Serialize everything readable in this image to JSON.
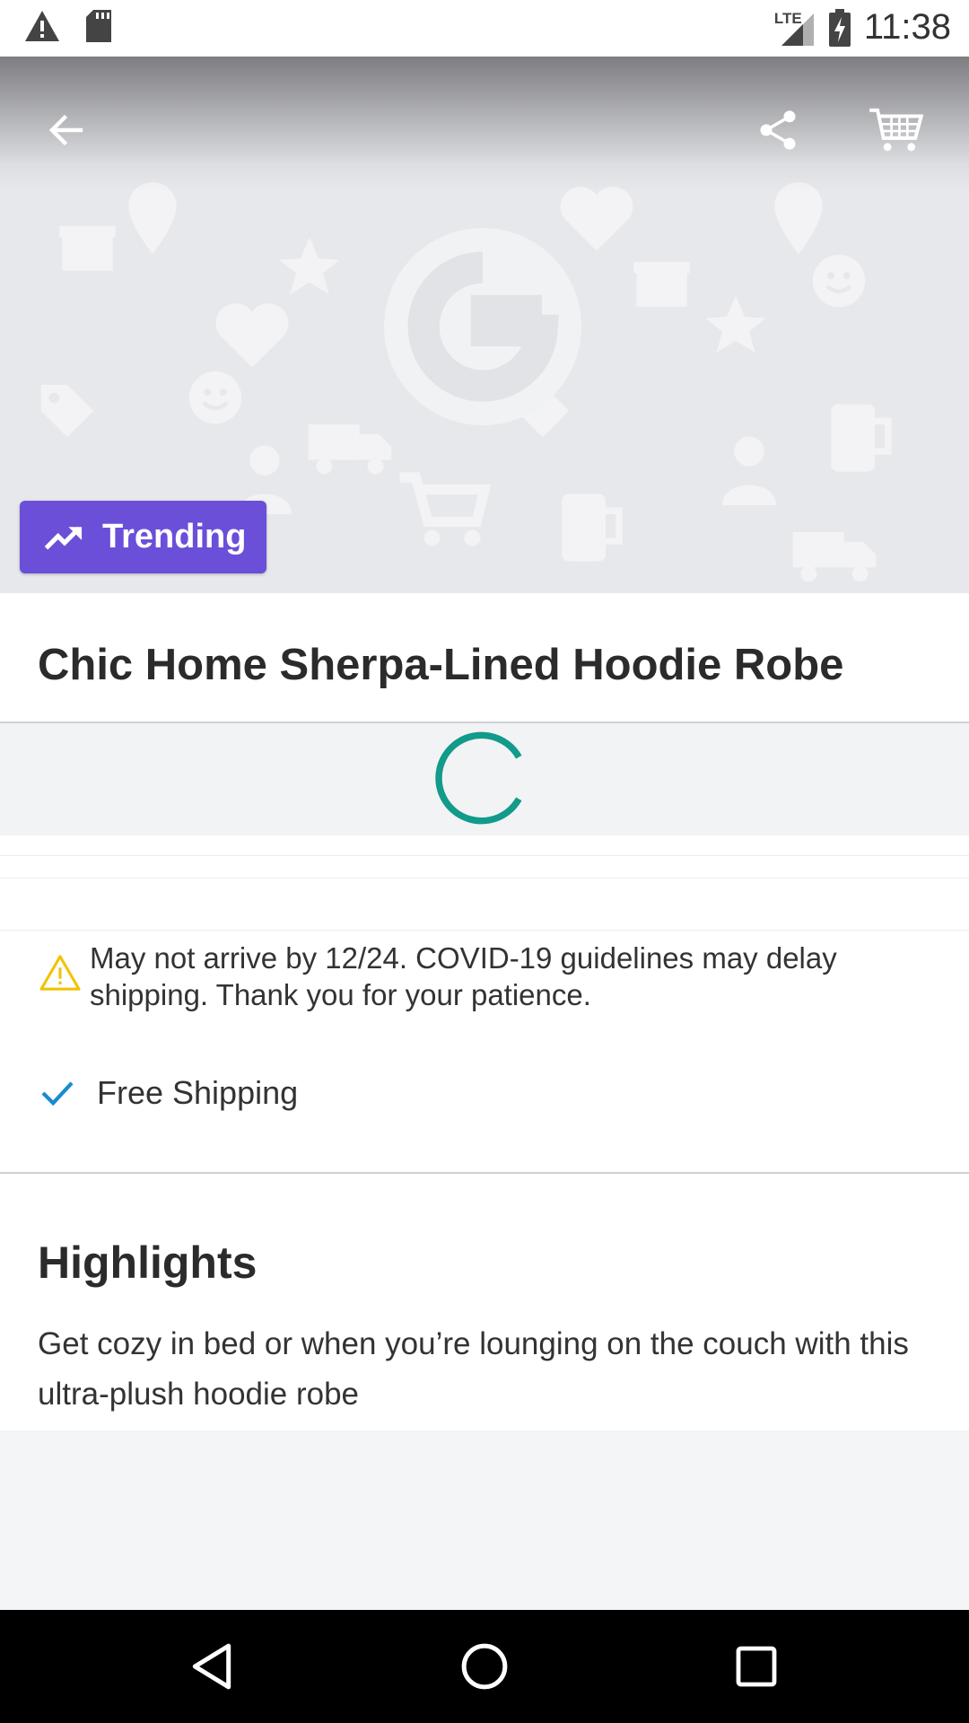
{
  "status_bar": {
    "time": "11:38",
    "network": "LTE",
    "icons": [
      "warning-icon",
      "sd-card-icon",
      "signal-icon",
      "battery-charging-icon"
    ]
  },
  "toolbar": {
    "back_icon": "arrow-back-icon",
    "share_icon": "share-icon",
    "cart_icon": "cart-icon"
  },
  "badge": {
    "label": "Trending",
    "icon": "trending-up-icon",
    "color": "#6b4fd8"
  },
  "product": {
    "title": "Chic Home Sherpa-Lined Hoodie Robe"
  },
  "shipping": {
    "notice": "May not arrive by 12/24. COVID-19 guidelines may delay shipping. Thank you for your patience.",
    "free_shipping": "Free Shipping",
    "warning_color": "#f2c200",
    "check_color": "#1a8bd0"
  },
  "highlights": {
    "heading": "Highlights",
    "text": "Get cozy in bed or when you’re lounging on the couch with this ultra-plush hoodie robe"
  },
  "loading": {
    "spinner_color": "#129a8a"
  },
  "nav_bar": {
    "icons": [
      "back-triangle-icon",
      "home-circle-icon",
      "recents-square-icon"
    ]
  }
}
